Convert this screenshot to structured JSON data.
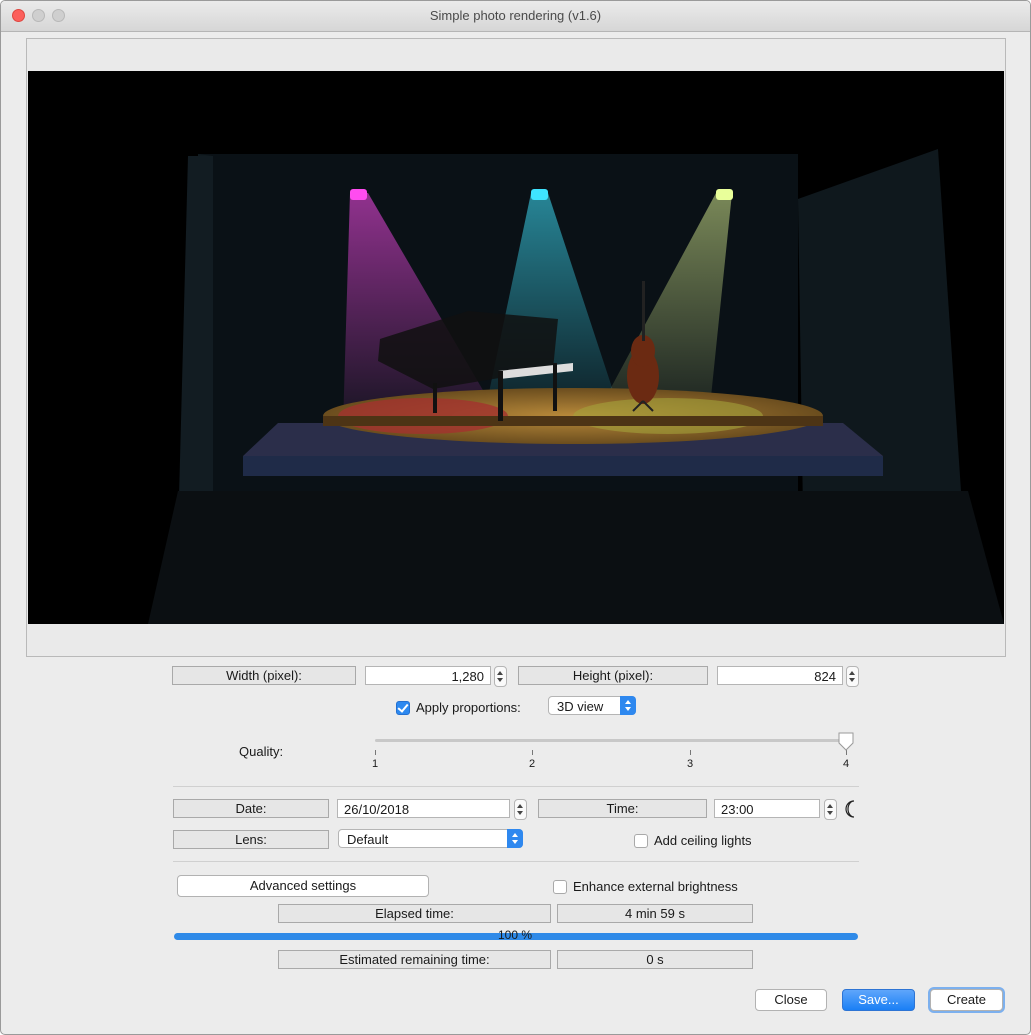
{
  "window": {
    "title": "Simple photo rendering (v1.6)"
  },
  "size": {
    "width_label": "Width (pixel):",
    "width_value": "1,280",
    "height_label": "Height (pixel):",
    "height_value": "824",
    "apply_proportions_label": "Apply proportions:",
    "apply_proportions_checked": true,
    "proportions_selected": "3D view"
  },
  "quality": {
    "label": "Quality:",
    "ticks": [
      "1",
      "2",
      "3",
      "4"
    ],
    "value": 4
  },
  "datetime": {
    "date_label": "Date:",
    "date_value": "26/10/2018",
    "time_label": "Time:",
    "time_value": "23:00",
    "moon_icon": "moon-icon"
  },
  "lens": {
    "label": "Lens:",
    "selected": "Default",
    "ceiling_lights_label": "Add ceiling lights",
    "ceiling_lights_checked": false
  },
  "advanced": {
    "button_label": "Advanced settings",
    "enhance_label": "Enhance external brightness",
    "enhance_checked": false
  },
  "progress": {
    "elapsed_label": "Elapsed time:",
    "elapsed_value": "4 min 59 s",
    "percent_text": "100 %",
    "fraction": 1.0,
    "remaining_label": "Estimated remaining time:",
    "remaining_value": "0 s"
  },
  "buttons": {
    "close": "Close",
    "save": "Save...",
    "create": "Create"
  },
  "colors": {
    "accent": "#2e88ef",
    "spot_magenta": "#ff3df0",
    "spot_cyan": "#32e6ff",
    "spot_yellow": "#e8ff8a"
  }
}
